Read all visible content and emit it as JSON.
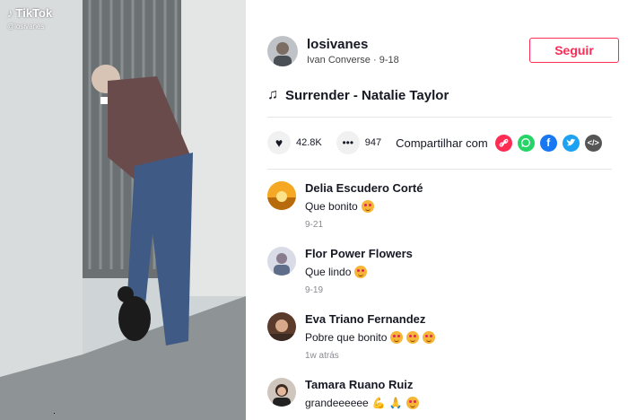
{
  "video": {
    "watermark_brand": "TikTok",
    "watermark_handle": "@losivanes"
  },
  "author": {
    "username": "losivanes",
    "subtitle": "Ivan Converse · 9-18"
  },
  "follow_label": "Seguir",
  "music": {
    "title": "Surrender - Natalie Taylor"
  },
  "actions": {
    "likes": "42.8K",
    "comments": "947",
    "share_label": "Compartilhar com"
  },
  "share_targets": [
    "link-icon",
    "whatsapp-icon",
    "facebook-icon",
    "twitter-icon",
    "embed-icon"
  ],
  "comments": [
    {
      "name": "Delia Escudero Corté",
      "text": "Que bonito",
      "emoji_count": 1,
      "time": "9-21"
    },
    {
      "name": "Flor Power Flowers",
      "text": "Que lindo",
      "emoji_count": 1,
      "time": "9-19"
    },
    {
      "name": "Eva Triano Fernandez",
      "text": "Pobre que bonito",
      "emoji_count": 3,
      "time": "1w atrás"
    },
    {
      "name": "Tamara Ruano Ruiz",
      "text": "grandeeeeee",
      "emoji_count": 3,
      "time": ""
    }
  ],
  "colors": {
    "accent": "#fe2c55",
    "whatsapp": "#25d366",
    "facebook": "#1877f2",
    "twitter": "#1da1f2",
    "embed": "#555"
  }
}
